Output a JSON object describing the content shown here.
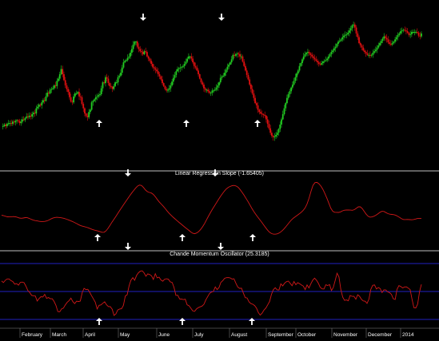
{
  "colors": {
    "background": "#000000",
    "candle_up": "#22cc22",
    "candle_down": "#e01010",
    "indicator_line": "#d01818",
    "band_line": "#2a2aff",
    "separator": "#ffffff",
    "arrow": "#ffffff"
  },
  "chart_data": [
    {
      "type": "candlestick",
      "name": "price",
      "title": "",
      "x_labels": [
        "February",
        "March",
        "April",
        "May",
        "June",
        "July",
        "August",
        "September",
        "October",
        "November",
        "December",
        "2014"
      ],
      "close": [
        66,
        66,
        68,
        66,
        69,
        70,
        70,
        69,
        72,
        71,
        73,
        74,
        73,
        70,
        72,
        75,
        74,
        77,
        79,
        78,
        80,
        79,
        82,
        84,
        83,
        90,
        92,
        95,
        94,
        98,
        101,
        100,
        106,
        111,
        110,
        115,
        116,
        117,
        121,
        120,
        127,
        130,
        136,
        143,
        136,
        128,
        121,
        116,
        112,
        105,
        99,
        98,
        106,
        110,
        110,
        112,
        106,
        105,
        96,
        90,
        83,
        80,
        78,
        85,
        88,
        98,
        100,
        102,
        105,
        106,
        108,
        109,
        117,
        125,
        124,
        132,
        130,
        124,
        120,
        119,
        116,
        120,
        125,
        125,
        132,
        134,
        138,
        145,
        152,
        154,
        155,
        158,
        160,
        165,
        170,
        176,
        180,
        180,
        173,
        170,
        167,
        166,
        163,
        167,
        166,
        160,
        157,
        154,
        150,
        146,
        144,
        142,
        140,
        136,
        133,
        129,
        124,
        120,
        116,
        114,
        115,
        117,
        121,
        126,
        131,
        135,
        140,
        143,
        144,
        145,
        146,
        147,
        150,
        153,
        157,
        160,
        160,
        157,
        152,
        147,
        145,
        141,
        136,
        130,
        125,
        122,
        117,
        115,
        115,
        113,
        111,
        111,
        114,
        114,
        115,
        118,
        121,
        125,
        131,
        133,
        134,
        138,
        142,
        146,
        149,
        152,
        156,
        162,
        161,
        163,
        164,
        163,
        160,
        160,
        153,
        147,
        141,
        135,
        129,
        122,
        116,
        110,
        104,
        97,
        94,
        88,
        85,
        83,
        82,
        81,
        80,
        75,
        69,
        63,
        57,
        53,
        51,
        52,
        54,
        57,
        62,
        68,
        75,
        82,
        90,
        97,
        104,
        109,
        113,
        118,
        122,
        127,
        132,
        137,
        141,
        147,
        151,
        156,
        160,
        163,
        165,
        166,
        164,
        162,
        160,
        158,
        156,
        154,
        152,
        150,
        149,
        151,
        153,
        154,
        155,
        157,
        160,
        163,
        166,
        168,
        171,
        173,
        177,
        180,
        181,
        183,
        186,
        188,
        189,
        190,
        192,
        195,
        198,
        202,
        203,
        199,
        191,
        186,
        178,
        175,
        172,
        168,
        166,
        164,
        162,
        162,
        161,
        162,
        165,
        167,
        169,
        172,
        175,
        178,
        181,
        184,
        187,
        185,
        183,
        179,
        177,
        176,
        178,
        180,
        183,
        186,
        189,
        191,
        194,
        195,
        196,
        195,
        194,
        192,
        189,
        190,
        193,
        193,
        193,
        193,
        192,
        188,
        187,
        191
      ]
    },
    {
      "type": "line",
      "name": "linear_regression_slope",
      "title": "Linear Regression Slope (-1.65405)",
      "values": [
        -0.6,
        -0.73,
        -0.95,
        -1.13,
        -1.17,
        -1.11,
        -1.07,
        -1.13,
        -1.31,
        -1.53,
        -1.61,
        -1.53,
        -1.41,
        -1.44,
        -1.65,
        -1.96,
        -2.22,
        -2.38,
        -2.5,
        -2.62,
        -2.7,
        -2.7,
        -2.64,
        -2.48,
        -2.19,
        -1.85,
        -1.56,
        -1.37,
        -1.31,
        -1.35,
        -1.44,
        -1.56,
        -1.72,
        -1.93,
        -2.18,
        -2.44,
        -2.71,
        -3.02,
        -3.36,
        -3.71,
        -4.02,
        -4.24,
        -4.41,
        -4.58,
        -4.79,
        -5.06,
        -5.33,
        -5.55,
        -5.7,
        -5.86,
        -6.08,
        -6.29,
        -6.26,
        -5.8,
        -4.96,
        -3.94,
        -2.93,
        -1.96,
        -0.99,
        0.03,
        1.06,
        2.04,
        3.0,
        3.95,
        4.91,
        5.86,
        6.76,
        7.59,
        8.38,
        9.07,
        9.43,
        9.27,
        8.6,
        7.79,
        7.23,
        6.97,
        6.76,
        6.3,
        5.52,
        4.61,
        3.8,
        3.11,
        2.4,
        1.62,
        0.8,
        0.03,
        -0.64,
        -1.24,
        -1.82,
        -2.4,
        -2.97,
        -3.51,
        -4.06,
        -4.59,
        -5.11,
        -5.63,
        -6.18,
        -6.62,
        -6.75,
        -6.51,
        -6.02,
        -5.34,
        -4.44,
        -3.33,
        -2.11,
        -0.87,
        0.32,
        1.41,
        2.47,
        3.53,
        4.57,
        5.59,
        6.52,
        7.39,
        8.12,
        8.65,
        8.98,
        9.2,
        9.28,
        9.12,
        8.67,
        7.93,
        7.03,
        6.05,
        5.03,
        3.95,
        2.79,
        1.64,
        0.58,
        -0.36,
        -1.24,
        -2.09,
        -2.96,
        -3.86,
        -4.77,
        -5.61,
        -6.29,
        -6.72,
        -6.91,
        -6.91,
        -6.76,
        -6.44,
        -5.96,
        -5.34,
        -4.61,
        -3.79,
        -2.96,
        -2.21,
        -1.6,
        -1.1,
        -0.63,
        -0.17,
        0.35,
        0.98,
        1.84,
        3.16,
        5.07,
        7.39,
        9.31,
        10.23,
        10.3,
        9.85,
        9.08,
        7.98,
        6.63,
        5.12,
        3.43,
        1.79,
        0.72,
        0.38,
        0.35,
        0.32,
        0.51,
        0.84,
        1.06,
        1.12,
        1.11,
        1.08,
        1.05,
        1.24,
        1.74,
        2.19,
        2.17,
        1.57,
        0.64,
        -0.29,
        -0.97,
        -1.25,
        -1.17,
        -0.92,
        -0.58,
        -0.11,
        0.38,
        0.69,
        0.63,
        0.28,
        -0.07,
        -0.26,
        -0.33,
        -0.42,
        -0.64,
        -0.98,
        -1.39,
        -1.79,
        -2.03,
        -2.03,
        -2.01,
        -2.08,
        -2.12,
        -2.05,
        -1.87,
        -1.69,
        -1.65,
        -1.65
      ],
      "ylim": [
        -9.5,
        12
      ]
    },
    {
      "type": "line",
      "name": "chande_momentum_oscillator",
      "title": "Chande Momentum Oscillator (25.3185)",
      "values": [
        37.4,
        31.9,
        40.2,
        44.8,
        44.8,
        38.9,
        35.3,
        26.2,
        28.2,
        22.5,
        32.7,
        33.6,
        31.4,
        18.7,
        3.3,
        -3.6,
        -13.7,
        -15.3,
        -16.3,
        -34.1,
        -25.2,
        -18.6,
        -19.6,
        -10.4,
        -24.7,
        -21.5,
        -25.8,
        -25.9,
        -35.3,
        -50.1,
        -71.8,
        -72.5,
        -62.3,
        -59.5,
        -48.1,
        -38.9,
        -32.6,
        -23.6,
        -36.2,
        -43.3,
        -34.5,
        -36.1,
        -34.2,
        -4.2,
        11.4,
        6.8,
        8.1,
        -2.9,
        -15.0,
        -26.2,
        -38.6,
        -62.6,
        -49.4,
        -48.0,
        -42.0,
        -37.0,
        -47.6,
        -53.9,
        -54.3,
        -63.3,
        -85.6,
        -80.0,
        -66.1,
        -62.7,
        -61.6,
        -50.1,
        -16.3,
        -11.7,
        19.6,
        40.0,
        49.4,
        40.2,
        57.4,
        66.8,
        72.5,
        74.0,
        66.8,
        54.6,
        63.1,
        60.5,
        56.1,
        42.8,
        63.7,
        49.0,
        51.3,
        41.3,
        36.8,
        44.1,
        45.4,
        43.6,
        34.7,
        32.2,
        14.6,
        -14.1,
        -13.4,
        -27.0,
        -27.1,
        -29.1,
        -27.7,
        -47.6,
        -51.0,
        -60.1,
        -69.8,
        -71.2,
        -62.1,
        -57.6,
        -54.8,
        -51.9,
        -45.4,
        -29.3,
        -18.1,
        -6.4,
        -2.1,
        0.1,
        16.2,
        7.0,
        14.2,
        32.6,
        39.0,
        47.1,
        49.4,
        49.6,
        48.5,
        44.3,
        45.4,
        29.5,
        16.3,
        11.2,
        11.6,
        -5.3,
        -22.1,
        -23.2,
        -37.1,
        -43.2,
        -45.6,
        -50.2,
        -59.7,
        -75.3,
        -84.5,
        -77.4,
        -66.6,
        -59.1,
        -47.8,
        -35.5,
        -10.0,
        6.2,
        13.4,
        5.9,
        5.4,
        27.5,
        20.1,
        29.6,
        35.1,
        37.2,
        29.1,
        20.5,
        35.6,
        24.2,
        31.4,
        27.7,
        23.0,
        19.1,
        6.6,
        23.5,
        12.6,
        27.3,
        40.5,
        47.6,
        40.3,
        29.6,
        15.2,
        9.3,
        8.8,
        24.1,
        21.5,
        24.5,
        3.5,
        14.4,
        39.7,
        65.5,
        51.9,
        7.6,
        -20.3,
        -31.8,
        -30.2,
        -33.2,
        -14.2,
        -17.5,
        -17.5,
        -27.6,
        -11.7,
        -17.3,
        -28.0,
        -33.6,
        -34.8,
        -42.7,
        -27.2,
        7.5,
        22.0,
        23.4,
        9.2,
        14.4,
        10.5,
        -3.9,
        5.6,
        5.3,
        -1.4,
        -3.9,
        -10.2,
        -25.8,
        -28.7,
        7.7,
        21.1,
        17.7,
        12.6,
        16.4,
        16.7,
        12.0,
        6.9,
        -28.1,
        -57.8,
        -58.8,
        -45.1,
        -0.4,
        25.3
      ],
      "bands": [
        100,
        0,
        -100
      ],
      "ylim": [
        -100,
        100
      ]
    }
  ],
  "arrows": [
    {
      "panel": 0,
      "direction": "down",
      "x": 179
    },
    {
      "panel": 0,
      "direction": "down",
      "x": 277
    },
    {
      "panel": 0,
      "direction": "up",
      "x": 124
    },
    {
      "panel": 0,
      "direction": "up",
      "x": 233
    },
    {
      "panel": 0,
      "direction": "up",
      "x": 322
    },
    {
      "panel": 1,
      "direction": "down",
      "x": 160
    },
    {
      "panel": 1,
      "direction": "down",
      "x": 269
    },
    {
      "panel": 1,
      "direction": "up",
      "x": 122
    },
    {
      "panel": 1,
      "direction": "up",
      "x": 228
    },
    {
      "panel": 1,
      "direction": "up",
      "x": 316
    },
    {
      "panel": 2,
      "direction": "down",
      "x": 160
    },
    {
      "panel": 2,
      "direction": "down",
      "x": 276
    },
    {
      "panel": 2,
      "direction": "up",
      "x": 124
    },
    {
      "panel": 2,
      "direction": "up",
      "x": 228
    },
    {
      "panel": 2,
      "direction": "up",
      "x": 315
    }
  ]
}
